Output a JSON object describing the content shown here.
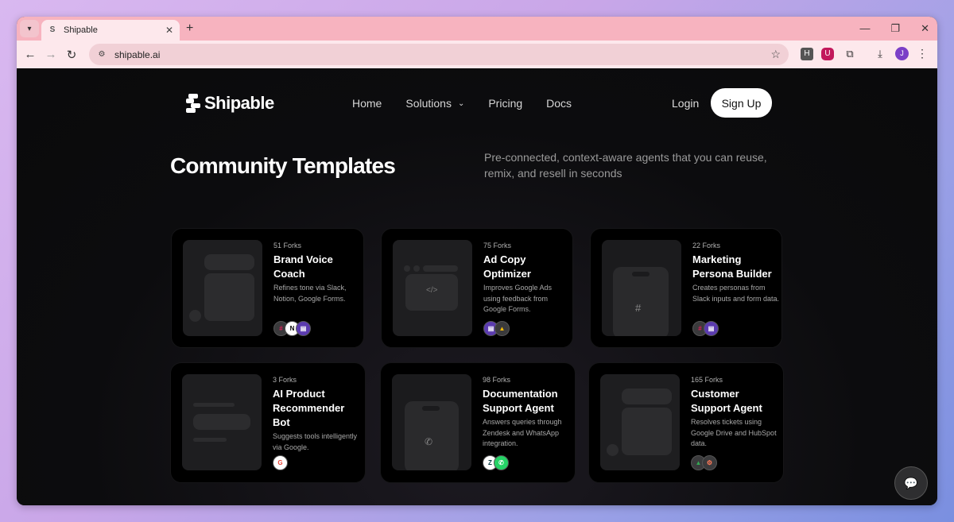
{
  "browser": {
    "tab_title": "Shipable",
    "url": "shipable.ai",
    "profile_initial": "J",
    "extensions": [
      "H",
      "U"
    ]
  },
  "nav": {
    "logo": "Shipable",
    "links": [
      "Home",
      "Solutions",
      "Pricing",
      "Docs"
    ],
    "login": "Login",
    "signup": "Sign Up"
  },
  "hero": {
    "title": "Community Templates",
    "subtitle": "Pre-connected, context-aware agents that you can reuse, remix, and resell in seconds"
  },
  "templates": [
    {
      "forks": "51 Forks",
      "title": "Brand Voice Coach",
      "desc": "Refines tone via Slack, Notion, Google Forms.",
      "integrations": [
        "slack-icon",
        "notion-icon",
        "google-forms-icon"
      ]
    },
    {
      "forks": "75 Forks",
      "title": "Ad Copy Optimizer",
      "desc": "Improves Google Ads using feedback from Google Forms.",
      "integrations": [
        "google-forms-icon",
        "google-ads-icon"
      ]
    },
    {
      "forks": "22 Forks",
      "title": "Marketing Persona Builder",
      "desc": "Creates personas from Slack inputs and form data.",
      "integrations": [
        "slack-icon",
        "google-forms-icon"
      ]
    },
    {
      "forks": "3 Forks",
      "title": "AI Product Recommender Bot",
      "desc": "Suggests tools intelligently via Google.",
      "integrations": [
        "google-icon"
      ]
    },
    {
      "forks": "98 Forks",
      "title": "Documentation Support Agent",
      "desc": "Answers queries through Zendesk and WhatsApp integration.",
      "integrations": [
        "zendesk-icon",
        "whatsapp-icon"
      ]
    },
    {
      "forks": "165 Forks",
      "title": "Customer Support Agent",
      "desc": "Resolves tickets using Google Drive and HubSpot data.",
      "integrations": [
        "google-drive-icon",
        "hubspot-icon"
      ]
    }
  ],
  "colors": {
    "page_bg": "#0b0b0d",
    "card_bg": "#000000",
    "signup_bg": "#ffffff",
    "titlebar": "#f7b3bf"
  }
}
